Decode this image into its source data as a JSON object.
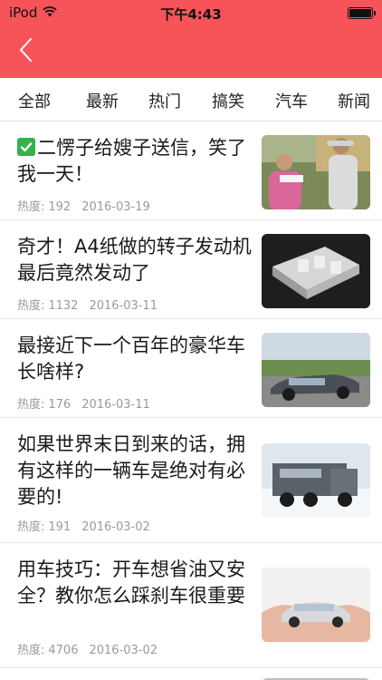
{
  "status_bar": {
    "carrier": "iPod",
    "time": "下午4:43"
  },
  "nav": {
    "back_icon": "chevron-left-icon",
    "bar_color": "#f7545a"
  },
  "tabs": [
    {
      "label": "全部"
    },
    {
      "label": "最新"
    },
    {
      "label": "热门"
    },
    {
      "label": "搞笑"
    },
    {
      "label": "汽车"
    },
    {
      "label": "新闻"
    }
  ],
  "articles": [
    {
      "title": "二愣子给嫂子送信，笑了我一天！",
      "views_label": "热度:",
      "views": "192",
      "date": "2016-03-19",
      "has_check_icon": true
    },
    {
      "title": "奇才！A4纸做的转子发动机 最后竟然发动了",
      "views_label": "热度:",
      "views": "1132",
      "date": "2016-03-11"
    },
    {
      "title": "最接近下一个百年的豪华车长啥样?",
      "views_label": "热度:",
      "views": "176",
      "date": "2016-03-11"
    },
    {
      "title": "如果世界末日到来的话，拥有这样的一辆车是绝对有必要的!",
      "views_label": "热度:",
      "views": "191",
      "date": "2016-03-02"
    },
    {
      "title": "用车技巧：开车想省油又安全？教你怎么踩刹车很重要",
      "views_label": "热度:",
      "views": "4706",
      "date": "2016-03-02"
    }
  ]
}
